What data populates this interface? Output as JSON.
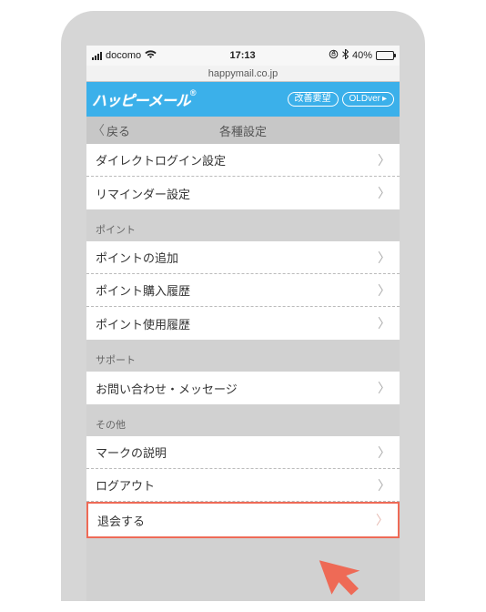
{
  "status": {
    "carrier": "docomo",
    "time": "17:13",
    "battery_pct": "40%"
  },
  "url_bar": {
    "domain": "happymail.co.jp"
  },
  "app_header": {
    "logo_text": "ハッピーメール",
    "reg_mark": "®",
    "btn_improve": "改善要望",
    "btn_oldver": "OLDver",
    "btn_old_suffix": "▸"
  },
  "sub_header": {
    "back_label": "戻る",
    "title": "各種設定"
  },
  "sections": {
    "login": {
      "items": {
        "direct_login": "ダイレクトログイン設定",
        "reminder": "リマインダー設定"
      }
    },
    "points": {
      "label": "ポイント",
      "items": {
        "add": "ポイントの追加",
        "purchase_history": "ポイント購入履歴",
        "use_history": "ポイント使用履歴"
      }
    },
    "support": {
      "label": "サポート",
      "items": {
        "contact": "お問い合わせ・メッセージ"
      }
    },
    "other": {
      "label": "その他",
      "items": {
        "marks": "マークの説明",
        "logout": "ログアウト",
        "withdraw": "退会する"
      }
    }
  }
}
